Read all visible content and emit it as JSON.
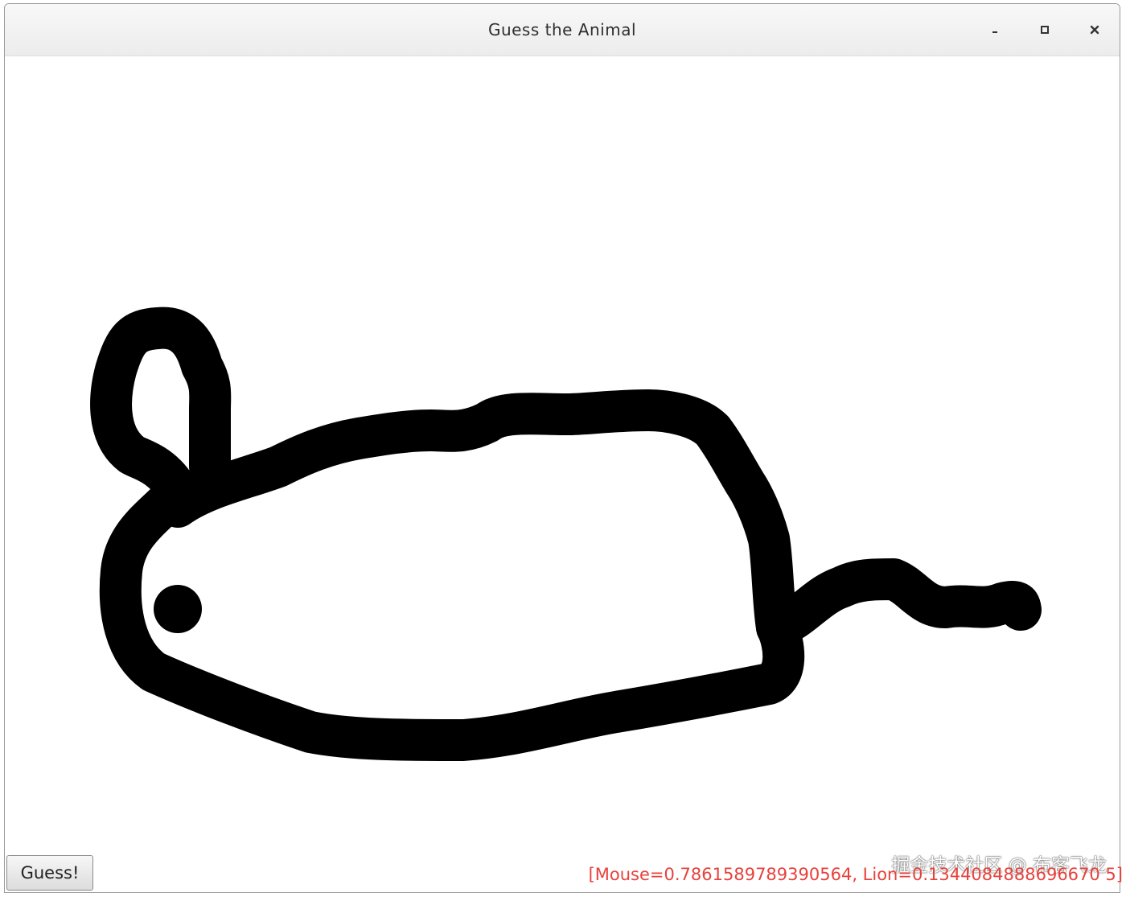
{
  "window": {
    "title": "Guess the Animal",
    "controls": [
      "minimize-icon",
      "maximize-icon",
      "close-icon"
    ]
  },
  "guess_button": {
    "label": "Guess!"
  },
  "result_text": "[Mouse=0.7861589789390564, Lion=0.1344084888696670 5]",
  "watermark": "掘金技术社区 @ 布客飞龙",
  "colors": {
    "result": "#e8413c",
    "stroke": "#000000"
  }
}
